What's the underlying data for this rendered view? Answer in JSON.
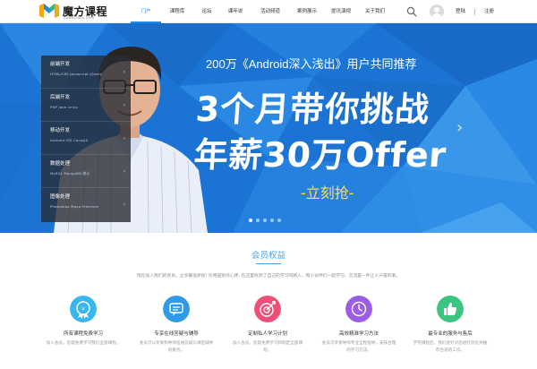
{
  "header": {
    "logo_text": "魔方课程",
    "logo_sub": "cubeclass.com",
    "nav": [
      "门户",
      "课程库",
      "论坛",
      "课年说",
      "活动频道",
      "案例展示",
      "提讯演视",
      "关于我们"
    ],
    "login": "登陆",
    "register": "注册"
  },
  "banner": {
    "headline": "200万《Android深入浅出》用户共同推荐",
    "big_line_1": "3个月带你挑战",
    "big_line_2": "年薪30万Offer",
    "cta": "-立刻抢-",
    "categories": [
      {
        "title": "前端开发",
        "sub": "HTML/CSS   Javascript   jQuery"
      },
      {
        "title": "后端开发",
        "sub": "PHP   Java   Linux"
      },
      {
        "title": "移动开发",
        "sub": "Android   iOS   CocosJS"
      },
      {
        "title": "数据处理",
        "sub": "MySQL   MongoDB   统计"
      },
      {
        "title": "图像处理",
        "sub": "Photoshop   Maya   Premiere"
      }
    ],
    "dot_count": 5,
    "active_dot": 0
  },
  "benefits": {
    "title": "会员权益",
    "desc": "现在加入我们的会员，立享最低折扣! 价格是别作心疼, 在这里找到了自己的学习同路人。和小伙伴们一起学习、交流是一件让人兴奋的事。",
    "items": [
      {
        "title": "所有课程免费学习",
        "desc": "加入会员。您就免费学习我们全部课程。",
        "color": "#38b6ef",
        "icon": "vip-badge-icon"
      },
      {
        "title": "专享在线答疑与辅导",
        "desc": "会员可以享受和导师在线答疑与课后辅导的服务。",
        "color": "#2f9be8",
        "icon": "chat-bubble-icon"
      },
      {
        "title": "定制私人学习计划",
        "desc": "加入会员。您就免费学习和制定全部课程。",
        "color": "#ee4f77",
        "icon": "target-icon"
      },
      {
        "title": "高效精准学习方法",
        "desc": "会员可享受导师专业全程指导，安排合理的学习方法。",
        "color": "#9b5de5",
        "icon": "clock-icon"
      },
      {
        "title": "最专业的服务与售后",
        "desc": "学完课程后，我们会针对您进行优化并推荐合适的工作。",
        "color": "#3cc481",
        "icon": "thumbs-up-icon"
      }
    ]
  }
}
